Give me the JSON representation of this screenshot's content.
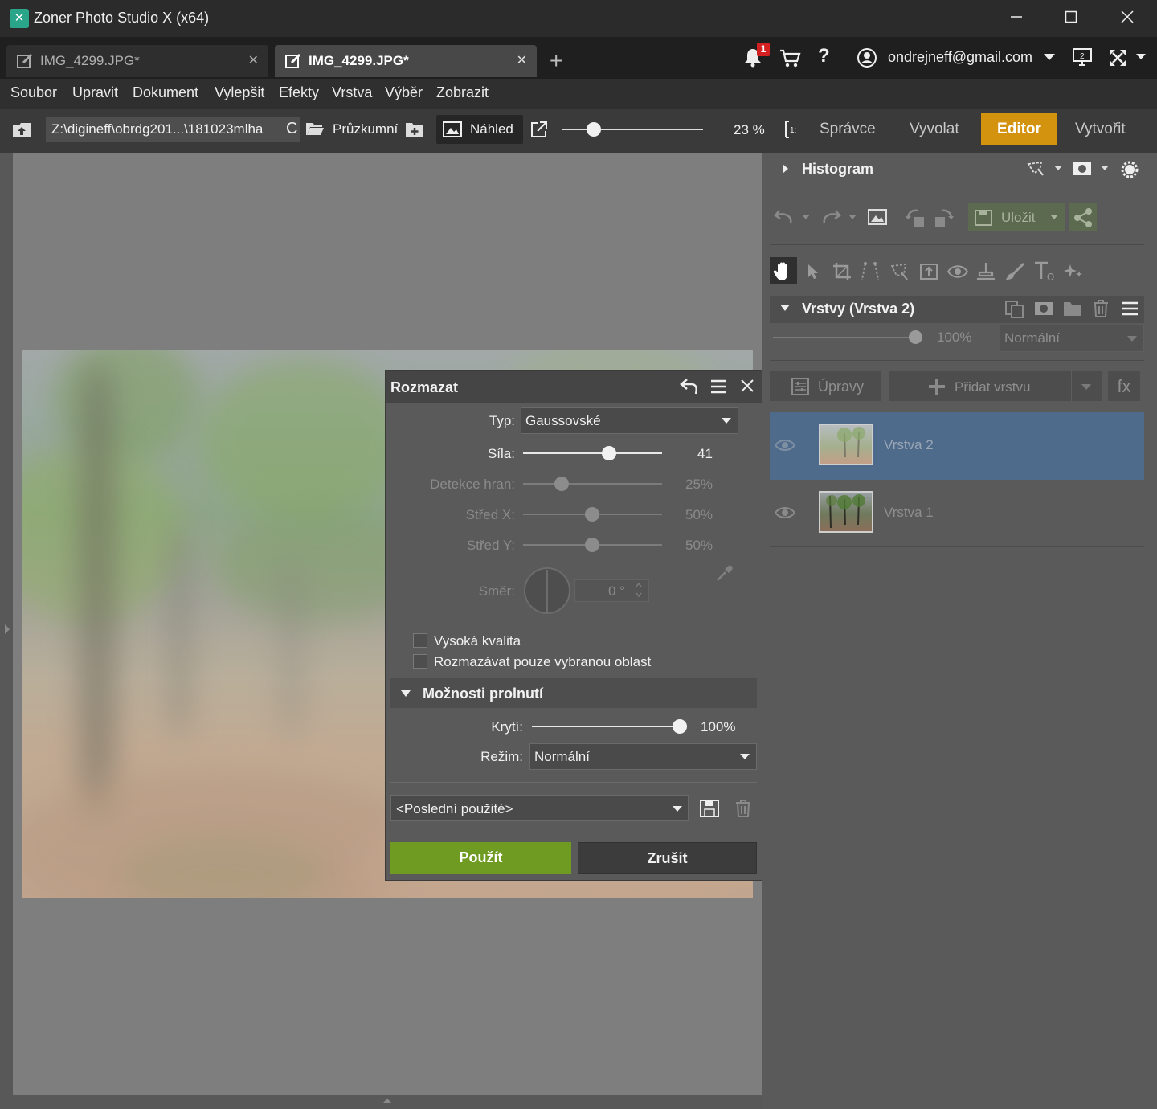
{
  "window": {
    "title": "Zoner Photo Studio X (x64)"
  },
  "tabs": [
    {
      "label": "IMG_4299.JPG*",
      "active": false
    },
    {
      "label": "IMG_4299.JPG*",
      "active": true
    }
  ],
  "top_right": {
    "notifications": "1",
    "help": "?",
    "user_email": "ondrejneff@gmail.com"
  },
  "menu": [
    "Soubor",
    "Upravit",
    "Dokument",
    "Vylepšit",
    "Efekty",
    "Vrstva",
    "Výběr",
    "Zobrazit"
  ],
  "toolbar": {
    "path": "Z:\\digineff\\obrdg201...\\181023mlha",
    "browser_label": "Průzkumní",
    "preview_label": "Náhled",
    "zoom": "23 %",
    "zoom_level": 0.23,
    "modes": [
      "Správce",
      "Vyvolat",
      "Editor",
      "Vytvořit"
    ],
    "active_mode": "Editor"
  },
  "right_panel": {
    "histogram_title": "Histogram",
    "save_label": "Uložit",
    "layers_title": "Vrstvy (Vrstva 2)",
    "opacity": "100%",
    "blend_mode": "Normální",
    "adjust_label": "Úpravy",
    "add_layer_label": "Přidat vrstvu",
    "fx_label": "fx",
    "layers": [
      {
        "name": "Vrstva 2",
        "selected": true
      },
      {
        "name": "Vrstva 1",
        "selected": false
      }
    ]
  },
  "dialog": {
    "title": "Rozmazat",
    "type_label": "Typ:",
    "type_value": "Gaussovské",
    "strength_label": "Síla:",
    "strength_value": "41",
    "edge_label": "Detekce hran:",
    "edge_value": "25%",
    "center_x_label": "Střed X:",
    "center_x_value": "50%",
    "center_y_label": "Střed Y:",
    "center_y_value": "50%",
    "direction_label": "Směr:",
    "direction_value": "0 °",
    "high_quality_label": "Vysoká kvalita",
    "selection_only_label": "Rozmazávat pouze vybranou oblast",
    "blend_section_title": "Možnosti prolnutí",
    "opacity_label": "Krytí:",
    "opacity_value": "100%",
    "mode_label": "Režim:",
    "mode_value": "Normální",
    "preset_value": "<Poslední použité>",
    "apply_label": "Použít",
    "cancel_label": "Zrušit"
  }
}
